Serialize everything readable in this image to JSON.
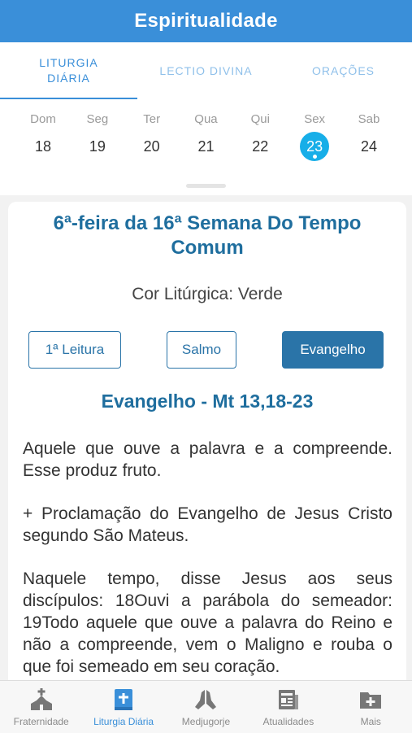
{
  "header": {
    "title": "Espiritualidade"
  },
  "tabs": [
    {
      "label": "LITURGIA DIÁRIA"
    },
    {
      "label": "LECTIO DIVINA"
    },
    {
      "label": "ORAÇÕES"
    }
  ],
  "calendar": {
    "days": [
      {
        "name": "Dom",
        "num": "18"
      },
      {
        "name": "Seg",
        "num": "19"
      },
      {
        "name": "Ter",
        "num": "20"
      },
      {
        "name": "Qua",
        "num": "21"
      },
      {
        "name": "Qui",
        "num": "22"
      },
      {
        "name": "Sex",
        "num": "23",
        "selected": true
      },
      {
        "name": "Sab",
        "num": "24"
      }
    ]
  },
  "card": {
    "title": "6ª-feira da 16ª Semana Do Tempo Comum",
    "color": "Cor Litúrgica: Verde",
    "buttons": {
      "b1": "1ª Leitura",
      "b2": "Salmo",
      "b3": "Evangelho"
    },
    "gospel_title": "Evangelho - Mt 13,18-23",
    "paragraphs": {
      "p1": "Aquele que ouve a palavra e a compreende. Esse produz fruto.",
      "p2": "+ Proclamação do Evangelho de Jesus Cristo segundo São Mateus.",
      "p3": "Naquele tempo, disse Jesus aos seus discípulos: 18Ouvi a parábola do semeador: 19Todo aquele que ouve a palavra do Reino e não a compreende, vem o Maligno e rouba o que foi semeado em seu coração."
    }
  },
  "tabbar": {
    "items": [
      {
        "label": "Fraternidade",
        "icon": "church-icon"
      },
      {
        "label": "Liturgia Diária",
        "icon": "bible-icon",
        "active": true
      },
      {
        "label": "Medjugorje",
        "icon": "praying-hands-icon"
      },
      {
        "label": "Atualidades",
        "icon": "newspaper-icon"
      },
      {
        "label": "Mais",
        "icon": "folder-plus-icon"
      }
    ]
  },
  "colors": {
    "primary": "#3a8fd9",
    "heading": "#1f6e9e",
    "button": "#2a74a8",
    "selected_day": "#17aee8"
  }
}
